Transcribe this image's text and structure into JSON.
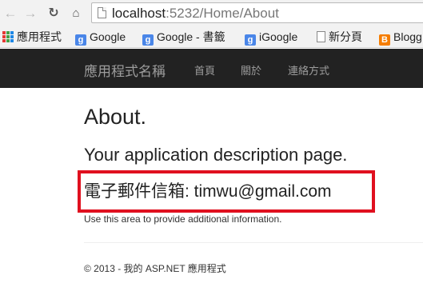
{
  "browser": {
    "url_host": "localhost",
    "url_path": ":5232/Home/About"
  },
  "bookmarks": [
    {
      "label": "應用程式",
      "icon": "apps-grid-icon"
    },
    {
      "label": "Google",
      "icon": "google-icon"
    },
    {
      "label": "Google - 書籤",
      "icon": "google-icon"
    },
    {
      "label": "iGoogle",
      "icon": "google-icon"
    },
    {
      "label": "新分頁",
      "icon": "page-icon"
    },
    {
      "label": "Blogg",
      "icon": "blogger-icon"
    }
  ],
  "navbar": {
    "brand": "應用程式名稱",
    "links": [
      "首頁",
      "關於",
      "連絡方式"
    ]
  },
  "main": {
    "title": "About.",
    "subtitle": "Your application description page.",
    "email_line": "電子郵件信箱: timwu@gmail.com",
    "info": "Use this area to provide additional information."
  },
  "footer": {
    "text": "© 2013 - 我的 ASP.NET 應用程式"
  },
  "colors": {
    "navbar_bg": "#222222",
    "nav_text": "#9d9d9d",
    "highlight_border": "#e0101f"
  }
}
